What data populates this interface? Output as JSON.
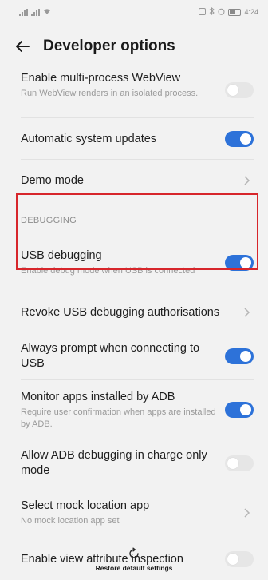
{
  "status_bar": {
    "right_text": "4:24"
  },
  "header": {
    "title": "Developer options",
    "back_icon": "back-arrow-icon"
  },
  "items": [
    {
      "primary": "Enable multi-process WebView",
      "secondary": "Run WebView renders in an isolated process.",
      "control": "toggle",
      "state": "off"
    },
    {
      "primary": "Automatic system updates",
      "control": "toggle",
      "state": "on"
    },
    {
      "primary": "Demo mode",
      "control": "chevron"
    }
  ],
  "section": {
    "label": "DEBUGGING"
  },
  "debug_items": [
    {
      "primary": "USB debugging",
      "secondary": "Enable debug mode when USB is connected",
      "control": "toggle",
      "state": "on"
    },
    {
      "primary": "Revoke USB debugging authorisations",
      "control": "chevron"
    },
    {
      "primary": "Always prompt when connecting to USB",
      "control": "toggle",
      "state": "on"
    },
    {
      "primary": "Monitor apps installed by ADB",
      "secondary": "Require user confirmation when apps are installed by ADB.",
      "control": "toggle",
      "state": "on"
    },
    {
      "primary": "Allow ADB debugging in charge only mode",
      "control": "toggle",
      "state": "off"
    },
    {
      "primary": "Select mock location app",
      "secondary": "No mock location app set",
      "control": "chevron"
    },
    {
      "primary": "Enable view attribute inspection",
      "control": "toggle",
      "state": "off"
    }
  ],
  "footer": {
    "restore_label": "Restore default settings",
    "icon": "refresh-icon"
  },
  "colors": {
    "accent": "#2d72d9",
    "highlight": "#d7262b",
    "background": "#f2f2f2"
  }
}
